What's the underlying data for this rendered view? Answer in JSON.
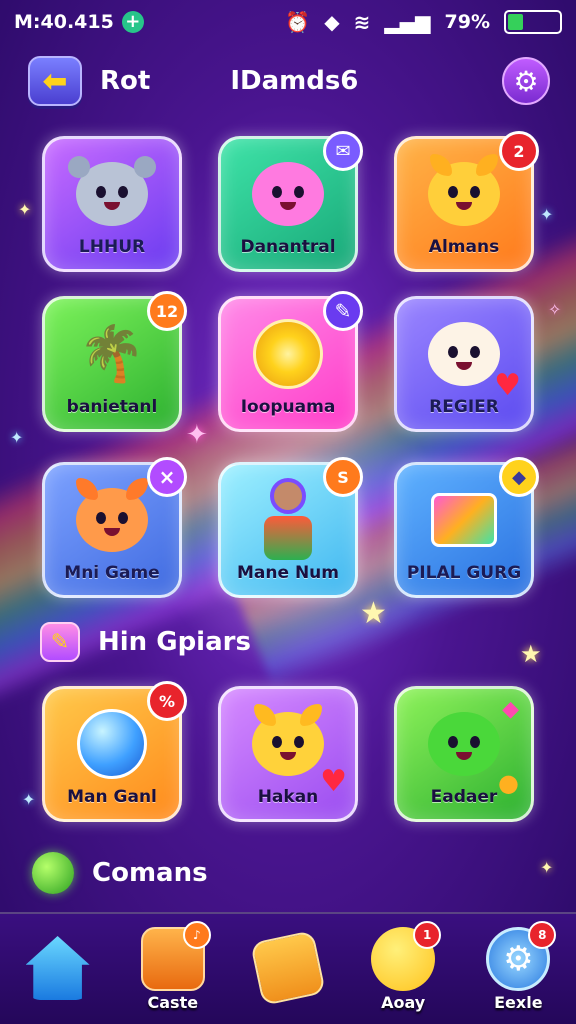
{
  "status_bar": {
    "time": "M:40.415",
    "battery_percent": "79%",
    "battery_level": 0.3,
    "colors": {
      "battery_fill": "#35d05a",
      "plus_dot": "#27c58a"
    }
  },
  "header": {
    "title_left": "Rot",
    "title_center": "IDamds6"
  },
  "tiles": [
    {
      "label": "LHHUR"
    },
    {
      "label": "Danantral"
    },
    {
      "label": "Almans",
      "badge": "2"
    },
    {
      "label": "banietanl",
      "badge": "12"
    },
    {
      "label": "Ioopuama"
    },
    {
      "label": "REGIER"
    },
    {
      "label": "Mni Game",
      "badge": "×"
    },
    {
      "label": "Mane Num",
      "badge": "S"
    },
    {
      "label": "PILAL GURG"
    },
    {
      "label": "Man Ganl",
      "badge": "%"
    },
    {
      "label": "Hakan"
    },
    {
      "label": "Eadaer"
    }
  ],
  "sections": {
    "featured": "Hin Gpiars",
    "comments": "Comans"
  },
  "bottom_nav": [
    {
      "label": "",
      "icon": "home-icon"
    },
    {
      "label": "Caste",
      "icon": "box-icon"
    },
    {
      "label": "",
      "icon": "chest-icon"
    },
    {
      "label": "Aoay",
      "icon": "character-icon",
      "badge": "1"
    },
    {
      "label": "Eexle",
      "icon": "settings-icon",
      "badge": "8"
    }
  ]
}
